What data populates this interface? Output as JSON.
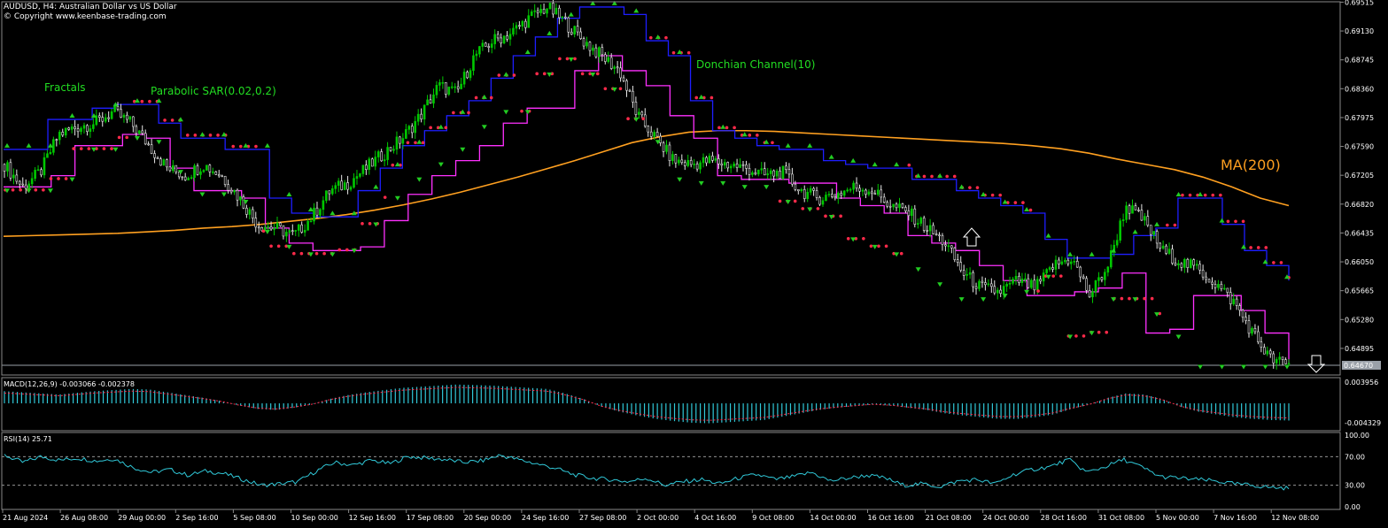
{
  "header": {
    "line1": "AUDUSD, H4:  Australian Dollar vs US Dollar",
    "line2": "© Copyright www.keenbase-trading.com"
  },
  "labels": {
    "fractals": "Fractals",
    "psar": "Parabolic SAR(0.02,0.2)",
    "donchian": "Donchian Channel(10)",
    "ma": "MA(200)",
    "macd": "MACD(12,26,9) -0.003066 -0.002378",
    "rsi": "RSI(14) 25.71"
  },
  "chart_data": {
    "type": "line",
    "instrument": "AUDUSD",
    "timeframe": "H4",
    "y_ticks": [
      "0.69515",
      "0.69130",
      "0.68745",
      "0.68360",
      "0.67975",
      "0.67590",
      "0.67205",
      "0.66820",
      "0.66435",
      "0.66050",
      "0.65665",
      "0.65280",
      "0.64895"
    ],
    "ylim": [
      0.6454,
      0.6952
    ],
    "current_price": "0.64670",
    "x_ticks": [
      "21 Aug 2024",
      "26 Aug 08:00",
      "29 Aug 00:00",
      "2 Sep 16:00",
      "5 Sep 08:00",
      "10 Sep 00:00",
      "12 Sep 16:00",
      "17 Sep 08:00",
      "20 Sep 00:00",
      "24 Sep 16:00",
      "27 Sep 08:00",
      "2 Oct 00:00",
      "4 Oct 16:00",
      "9 Oct 08:00",
      "14 Oct 00:00",
      "16 Oct 16:00",
      "21 Oct 08:00",
      "24 Oct 00:00",
      "28 Oct 16:00",
      "31 Oct 08:00",
      "5 Nov 00:00",
      "7 Nov 16:00",
      "12 Nov 08:00"
    ],
    "price_close": [
      0.6735,
      0.6705,
      0.6725,
      0.6775,
      0.6785,
      0.679,
      0.6805,
      0.679,
      0.676,
      0.673,
      0.672,
      0.6735,
      0.672,
      0.669,
      0.6655,
      0.665,
      0.664,
      0.6665,
      0.67,
      0.671,
      0.673,
      0.675,
      0.677,
      0.68,
      0.684,
      0.683,
      0.688,
      0.69,
      0.691,
      0.693,
      0.6945,
      0.6925,
      0.69,
      0.688,
      0.686,
      0.68,
      0.677,
      0.674,
      0.6735,
      0.674,
      0.6735,
      0.673,
      0.672,
      0.6725,
      0.67,
      0.669,
      0.6695,
      0.6705,
      0.67,
      0.668,
      0.667,
      0.665,
      0.663,
      0.659,
      0.657,
      0.6565,
      0.658,
      0.657,
      0.66,
      0.661,
      0.656,
      0.66,
      0.668,
      0.666,
      0.662,
      0.6605,
      0.6595,
      0.6575,
      0.655,
      0.651,
      0.6475,
      0.6467
    ],
    "ma200": [
      0.6639,
      0.664,
      0.6641,
      0.6642,
      0.6643,
      0.6645,
      0.6647,
      0.665,
      0.6652,
      0.6655,
      0.6659,
      0.6663,
      0.6668,
      0.6674,
      0.6681,
      0.6689,
      0.6698,
      0.6708,
      0.6718,
      0.6729,
      0.674,
      0.6752,
      0.6764,
      0.6772,
      0.6778,
      0.678,
      0.678,
      0.6779,
      0.6777,
      0.6775,
      0.6773,
      0.6771,
      0.6769,
      0.6767,
      0.6765,
      0.6763,
      0.676,
      0.6756,
      0.675,
      0.6742,
      0.6735,
      0.6728,
      0.6718,
      0.6705,
      0.669,
      0.668
    ],
    "donchian_upper": [
      0.6755,
      0.6755,
      0.6795,
      0.6795,
      0.681,
      0.6815,
      0.6815,
      0.679,
      0.677,
      0.677,
      0.6755,
      0.6755,
      0.669,
      0.667,
      0.6665,
      0.6665,
      0.67,
      0.673,
      0.676,
      0.678,
      0.68,
      0.682,
      0.685,
      0.688,
      0.6905,
      0.693,
      0.6945,
      0.6945,
      0.6935,
      0.69,
      0.688,
      0.682,
      0.678,
      0.677,
      0.676,
      0.6755,
      0.6755,
      0.674,
      0.6735,
      0.673,
      0.673,
      0.6715,
      0.6715,
      0.67,
      0.669,
      0.668,
      0.667,
      0.6635,
      0.661,
      0.661,
      0.6615,
      0.664,
      0.665,
      0.669,
      0.669,
      0.6655,
      0.662,
      0.66,
      0.658
    ],
    "donchian_lower": [
      0.6705,
      0.6705,
      0.672,
      0.676,
      0.676,
      0.6775,
      0.677,
      0.673,
      0.67,
      0.67,
      0.669,
      0.665,
      0.663,
      0.662,
      0.662,
      0.6625,
      0.666,
      0.6695,
      0.672,
      0.674,
      0.676,
      0.679,
      0.681,
      0.681,
      0.686,
      0.688,
      0.686,
      0.684,
      0.68,
      0.677,
      0.672,
      0.6715,
      0.6715,
      0.671,
      0.671,
      0.669,
      0.668,
      0.667,
      0.664,
      0.663,
      0.662,
      0.66,
      0.658,
      0.656,
      0.656,
      0.6565,
      0.657,
      0.659,
      0.651,
      0.6515,
      0.656,
      0.656,
      0.654,
      0.651,
      0.647
    ],
    "macd_hist": [
      0.0022,
      0.002,
      0.0018,
      0.0016,
      0.0019,
      0.0022,
      0.0024,
      0.0026,
      0.0025,
      0.002,
      0.0015,
      0.001,
      0.0004,
      -0.0004,
      -0.001,
      -0.0012,
      -0.0008,
      -0.0002,
      0.0008,
      0.0015,
      0.002,
      0.0024,
      0.0028,
      0.003,
      0.0032,
      0.0034,
      0.0033,
      0.0032,
      0.003,
      0.0028,
      0.0026,
      0.0018,
      0.0008,
      -0.0006,
      -0.0015,
      -0.0022,
      -0.0028,
      -0.0032,
      -0.0035,
      -0.0036,
      -0.0034,
      -0.0032,
      -0.003,
      -0.0024,
      -0.0018,
      -0.0012,
      -0.0008,
      -0.0005,
      -0.0002,
      -0.0004,
      -0.0008,
      -0.0012,
      -0.0018,
      -0.0022,
      -0.0025,
      -0.0028,
      -0.0028,
      -0.0025,
      -0.002,
      -0.001,
      -0.0002,
      0.001,
      0.0018,
      0.0016,
      0.0008,
      -0.0006,
      -0.0015,
      -0.002,
      -0.0025,
      -0.0028,
      -0.003,
      -0.0031
    ],
    "macd_y_ticks": [
      "0.003956",
      "-0.004329"
    ],
    "rsi": [
      72,
      62,
      70,
      65,
      68,
      64,
      67,
      55,
      48,
      52,
      44,
      50,
      46,
      38,
      30,
      32,
      35,
      50,
      62,
      58,
      65,
      60,
      70,
      68,
      66,
      62,
      64,
      72,
      66,
      60,
      54,
      45,
      40,
      38,
      35,
      40,
      30,
      35,
      38,
      32,
      40,
      45,
      38,
      42,
      48,
      36,
      40,
      44,
      40,
      30,
      32,
      28,
      36,
      38,
      32,
      45,
      52,
      56,
      66,
      48,
      56,
      66,
      55,
      42,
      40,
      38,
      36,
      32,
      30,
      27,
      26
    ],
    "rsi_y_ticks": [
      "100.00",
      "70.00",
      "30.00",
      "0.00"
    ],
    "colors": {
      "up_candle": "#00c800",
      "donchian_upper": "#1e1eff",
      "donchian_lower": "#ff30ff",
      "ma": "#ffa020",
      "psar": "#ff2a4a",
      "macd": "#30c8d8",
      "rsi": "#30c8d8",
      "fractal": "#22cc22"
    },
    "grid": false
  }
}
